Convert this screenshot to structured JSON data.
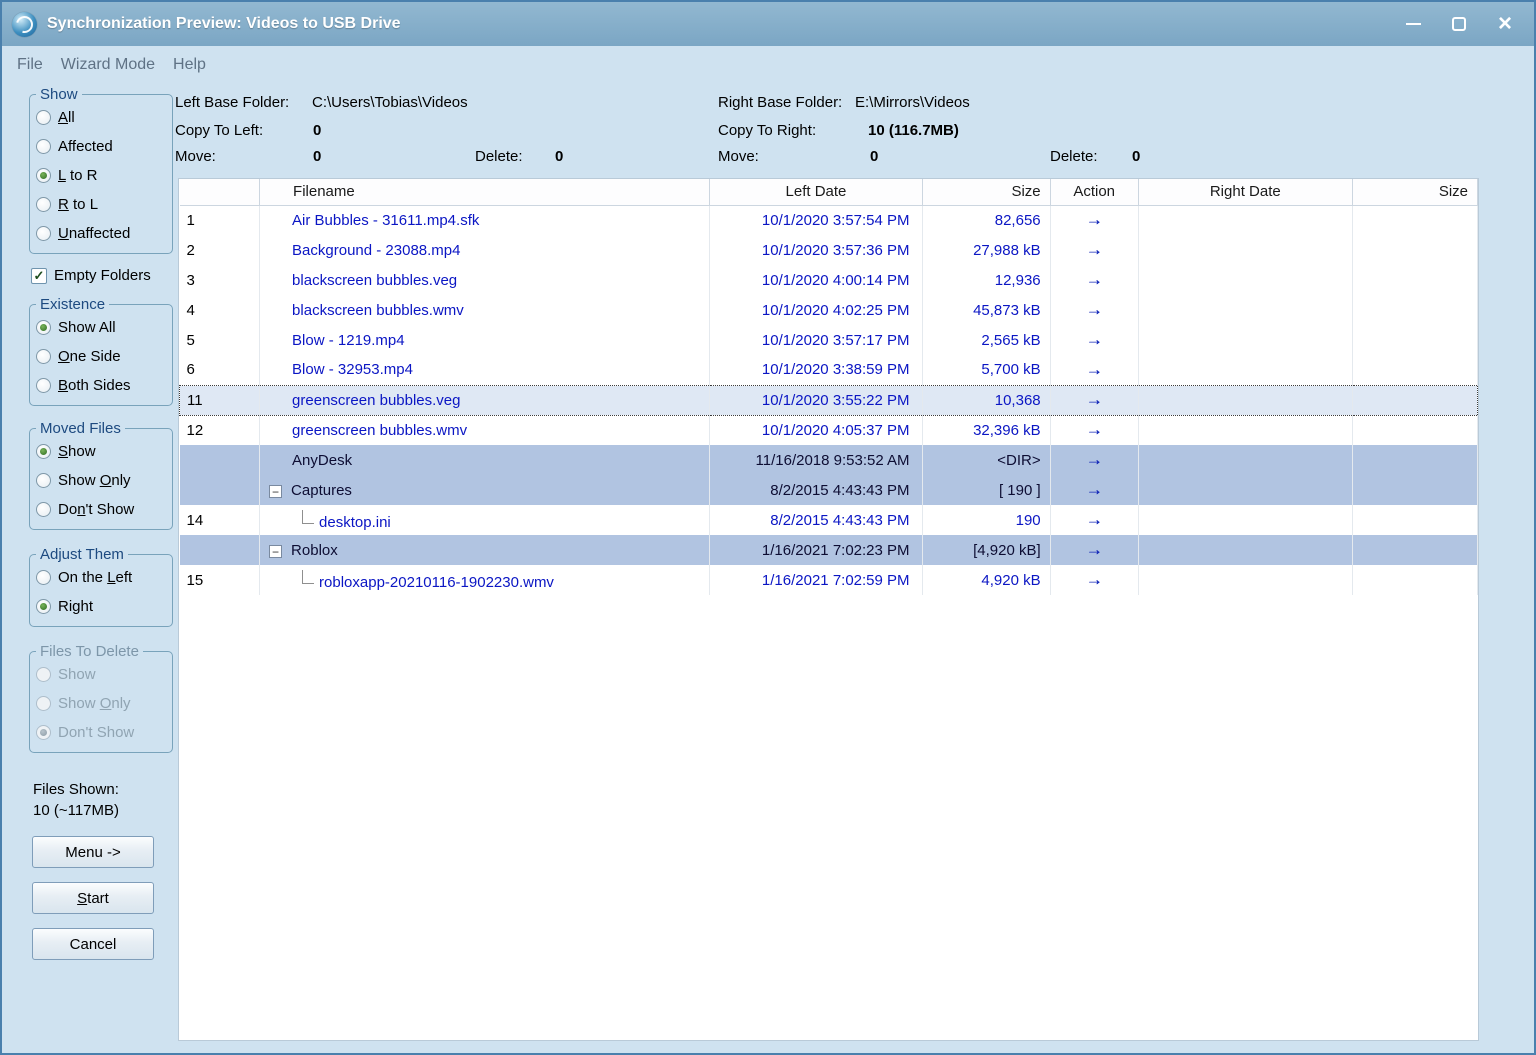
{
  "icons": {
    "close": "×",
    "check": "✓",
    "collapse": "−",
    "copy_right_arrow": "→"
  },
  "colors": {
    "titlebar": "#7ba6c4",
    "window_bg": "#cfe2f0",
    "dir_row_bg": "#b1c4e1",
    "file_text": "#0b16c4",
    "group_border": "#79a3bb"
  },
  "window": {
    "title": "Synchronization Preview: Videos to USB Drive",
    "icon": "sync-app-icon"
  },
  "menu": {
    "items": [
      {
        "label": "File"
      },
      {
        "label": "Wizard Mode"
      },
      {
        "label": "Help"
      }
    ]
  },
  "sidebar": {
    "groups": {
      "show": {
        "label": "Show",
        "disabled": false,
        "options": [
          {
            "label": "All",
            "accel": "A",
            "selected": false
          },
          {
            "label": "Affected",
            "accel": "",
            "selected": false
          },
          {
            "label": "L to R",
            "accel": "L",
            "selected": true
          },
          {
            "label": "R to L",
            "accel": "R",
            "selected": false
          },
          {
            "label": "Unaffected",
            "accel": "U",
            "selected": false
          }
        ]
      },
      "existence": {
        "label": "Existence",
        "disabled": false,
        "options": [
          {
            "label": "Show All",
            "accel": "",
            "selected": true
          },
          {
            "label": "One Side",
            "accel": "O",
            "selected": false
          },
          {
            "label": "Both Sides",
            "accel": "B",
            "selected": false
          }
        ]
      },
      "moved_files": {
        "label": "Moved Files",
        "disabled": false,
        "options": [
          {
            "label": "Show",
            "accel": "S",
            "selected": true
          },
          {
            "label": "Show Only",
            "accel": "O",
            "selected": false
          },
          {
            "label": "Don't Show",
            "accel": "n",
            "selected": false
          }
        ]
      },
      "adjust_them": {
        "label": "Adjust Them",
        "disabled": false,
        "options": [
          {
            "label": "On the Left",
            "accel": "L",
            "selected": false
          },
          {
            "label": "Right",
            "accel": "",
            "selected": true
          }
        ]
      },
      "files_to_delete": {
        "label": "Files To Delete",
        "disabled": true,
        "options": [
          {
            "label": "Show",
            "accel": "",
            "selected": false
          },
          {
            "label": "Show Only",
            "accel": "O",
            "selected": false
          },
          {
            "label": "Don't Show",
            "accel": "",
            "selected": true
          }
        ]
      }
    },
    "empty_folders": {
      "label": "Empty Folders",
      "checked": true
    },
    "files_shown": {
      "label": "Files Shown:",
      "value": "10 (~117MB)"
    },
    "buttons": [
      {
        "label": "Menu ->",
        "accel": ""
      },
      {
        "label": "Start",
        "accel": "S"
      },
      {
        "label": "Cancel",
        "accel": ""
      }
    ]
  },
  "summary": {
    "left_base_label": "Left Base Folder:",
    "left_base_value": "C:\\Users\\Tobias\\Videos",
    "right_base_label": "Right Base Folder:",
    "right_base_value": "E:\\Mirrors\\Videos",
    "copy_to_left_label": "Copy To Left:",
    "copy_to_left_value": "0",
    "copy_to_right_label": "Copy To Right:",
    "copy_to_right_value": "10 (116.7MB)",
    "left_move_label": "Move:",
    "left_move_value": "0",
    "left_delete_label": "Delete:",
    "left_delete_value": "0",
    "right_move_label": "Move:",
    "right_move_value": "0",
    "right_delete_label": "Delete:",
    "right_delete_value": "0"
  },
  "table": {
    "headers": {
      "num": "",
      "filename": "Filename",
      "left_date": "Left Date",
      "left_size": "Size",
      "action": "Action",
      "right_date": "Right Date",
      "right_size": "Size"
    },
    "rows": [
      {
        "num": "1",
        "name": "Air Bubbles - 31611.mp4.sfk",
        "type": "file",
        "expander": false,
        "selected": false,
        "left_date": "10/1/2020 3:57:54 PM",
        "size": "82,656",
        "action": "copy-right",
        "right_date": "",
        "right_size": ""
      },
      {
        "num": "2",
        "name": "Background - 23088.mp4",
        "type": "file",
        "expander": false,
        "selected": false,
        "left_date": "10/1/2020 3:57:36 PM",
        "size": "27,988 kB",
        "action": "copy-right",
        "right_date": "",
        "right_size": ""
      },
      {
        "num": "3",
        "name": "blackscreen bubbles.veg",
        "type": "file",
        "expander": false,
        "selected": false,
        "left_date": "10/1/2020 4:00:14 PM",
        "size": "12,936",
        "action": "copy-right",
        "right_date": "",
        "right_size": ""
      },
      {
        "num": "4",
        "name": "blackscreen bubbles.wmv",
        "type": "file",
        "expander": false,
        "selected": false,
        "left_date": "10/1/2020 4:02:25 PM",
        "size": "45,873 kB",
        "action": "copy-right",
        "right_date": "",
        "right_size": ""
      },
      {
        "num": "5",
        "name": "Blow - 1219.mp4",
        "type": "file",
        "expander": false,
        "selected": false,
        "left_date": "10/1/2020 3:57:17 PM",
        "size": "2,565 kB",
        "action": "copy-right",
        "right_date": "",
        "right_size": ""
      },
      {
        "num": "6",
        "name": "Blow - 32953.mp4",
        "type": "file",
        "expander": false,
        "selected": false,
        "left_date": "10/1/2020 3:38:59 PM",
        "size": "5,700 kB",
        "action": "copy-right",
        "right_date": "",
        "right_size": ""
      },
      {
        "num": "11",
        "name": "greenscreen bubbles.veg",
        "type": "file",
        "expander": false,
        "selected": true,
        "left_date": "10/1/2020 3:55:22 PM",
        "size": "10,368",
        "action": "copy-right",
        "right_date": "",
        "right_size": ""
      },
      {
        "num": "12",
        "name": "greenscreen bubbles.wmv",
        "type": "file",
        "expander": false,
        "selected": false,
        "left_date": "10/1/2020 4:05:37 PM",
        "size": "32,396 kB",
        "action": "copy-right",
        "right_date": "",
        "right_size": ""
      },
      {
        "num": "",
        "name": "AnyDesk",
        "type": "dir",
        "expander": false,
        "selected": false,
        "left_date": "11/16/2018 9:53:52 AM",
        "size": "<DIR>",
        "action": "copy-right",
        "right_date": "",
        "right_size": ""
      },
      {
        "num": "",
        "name": "Captures",
        "type": "dir",
        "expander": true,
        "selected": false,
        "left_date": "8/2/2015 4:43:43 PM",
        "size": "[ 190 ]",
        "action": "copy-right",
        "right_date": "",
        "right_size": ""
      },
      {
        "num": "14",
        "name": "desktop.ini",
        "type": "child",
        "expander": false,
        "selected": false,
        "left_date": "8/2/2015 4:43:43 PM",
        "size": "190",
        "action": "copy-right",
        "right_date": "",
        "right_size": ""
      },
      {
        "num": "",
        "name": "Roblox",
        "type": "dir",
        "expander": true,
        "selected": false,
        "left_date": "1/16/2021 7:02:23 PM",
        "size": "[4,920 kB]",
        "action": "copy-right",
        "right_date": "",
        "right_size": ""
      },
      {
        "num": "15",
        "name": "robloxapp-20210116-1902230.wmv",
        "type": "child",
        "expander": false,
        "selected": false,
        "left_date": "1/16/2021 7:02:59 PM",
        "size": "4,920 kB",
        "action": "copy-right",
        "right_date": "",
        "right_size": ""
      }
    ]
  }
}
